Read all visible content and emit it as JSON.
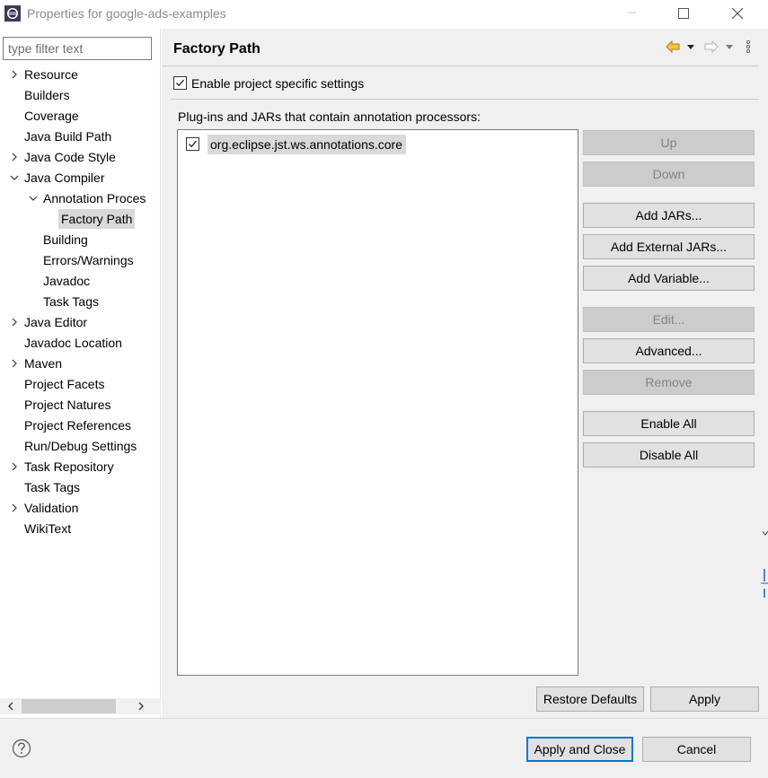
{
  "window": {
    "title": "Properties for google-ads-examples",
    "icons": {
      "app": "eclipse-icon",
      "minimize": "minimize-icon",
      "maximize": "maximize-icon",
      "close": "close-icon"
    }
  },
  "filter": {
    "placeholder": "type filter text",
    "value": ""
  },
  "tree": [
    {
      "label": "Resource",
      "indent": 0,
      "expander": "collapsed"
    },
    {
      "label": "Builders",
      "indent": 0,
      "expander": "none"
    },
    {
      "label": "Coverage",
      "indent": 0,
      "expander": "none"
    },
    {
      "label": "Java Build Path",
      "indent": 0,
      "expander": "none"
    },
    {
      "label": "Java Code Style",
      "indent": 0,
      "expander": "collapsed"
    },
    {
      "label": "Java Compiler",
      "indent": 0,
      "expander": "expanded"
    },
    {
      "label": "Annotation Proces",
      "indent": 1,
      "expander": "expanded"
    },
    {
      "label": "Factory Path",
      "indent": 2,
      "expander": "none",
      "selected": true
    },
    {
      "label": "Building",
      "indent": 1,
      "expander": "none"
    },
    {
      "label": "Errors/Warnings",
      "indent": 1,
      "expander": "none"
    },
    {
      "label": "Javadoc",
      "indent": 1,
      "expander": "none"
    },
    {
      "label": "Task Tags",
      "indent": 1,
      "expander": "none"
    },
    {
      "label": "Java Editor",
      "indent": 0,
      "expander": "collapsed"
    },
    {
      "label": "Javadoc Location",
      "indent": 0,
      "expander": "none"
    },
    {
      "label": "Maven",
      "indent": 0,
      "expander": "collapsed"
    },
    {
      "label": "Project Facets",
      "indent": 0,
      "expander": "none"
    },
    {
      "label": "Project Natures",
      "indent": 0,
      "expander": "none"
    },
    {
      "label": "Project References",
      "indent": 0,
      "expander": "none"
    },
    {
      "label": "Run/Debug Settings",
      "indent": 0,
      "expander": "none"
    },
    {
      "label": "Task Repository",
      "indent": 0,
      "expander": "collapsed"
    },
    {
      "label": "Task Tags",
      "indent": 0,
      "expander": "none"
    },
    {
      "label": "Validation",
      "indent": 0,
      "expander": "collapsed"
    },
    {
      "label": "WikiText",
      "indent": 0,
      "expander": "none"
    }
  ],
  "page": {
    "title": "Factory Path",
    "nav_icons": [
      "back-arrow-icon",
      "back-dropdown-icon",
      "forward-arrow-icon",
      "forward-dropdown-icon",
      "view-menu-icon"
    ],
    "enable_specific": {
      "label": "Enable project specific settings",
      "checked": true
    },
    "list_label": "Plug-ins and JARs that contain annotation processors:",
    "jars": [
      {
        "label": "org.eclipse.jst.ws.annotations.core",
        "checked": true
      }
    ],
    "side_buttons": [
      {
        "label": "Up",
        "enabled": false
      },
      {
        "label": "Down",
        "enabled": false
      },
      {
        "label": "Add JARs...",
        "enabled": true
      },
      {
        "label": "Add External JARs...",
        "enabled": true
      },
      {
        "label": "Add Variable...",
        "enabled": true
      },
      {
        "label": "Edit...",
        "enabled": false
      },
      {
        "label": "Advanced...",
        "enabled": true
      },
      {
        "label": "Remove",
        "enabled": false
      },
      {
        "label": "Enable All",
        "enabled": true
      },
      {
        "label": "Disable All",
        "enabled": true
      }
    ],
    "restore_defaults": "Restore Defaults",
    "apply": "Apply"
  },
  "footer": {
    "help_icon": "help-icon",
    "apply_and_close": "Apply and Close",
    "cancel": "Cancel"
  },
  "colors": {
    "panel_bg": "#f0f0f0",
    "selection_bg": "#d9d9d9",
    "button_bg": "#e1e1e1",
    "disabled_button_bg": "#cccccc",
    "default_button_border": "#0078d7",
    "nav_arrow_active": "#e8a317"
  }
}
